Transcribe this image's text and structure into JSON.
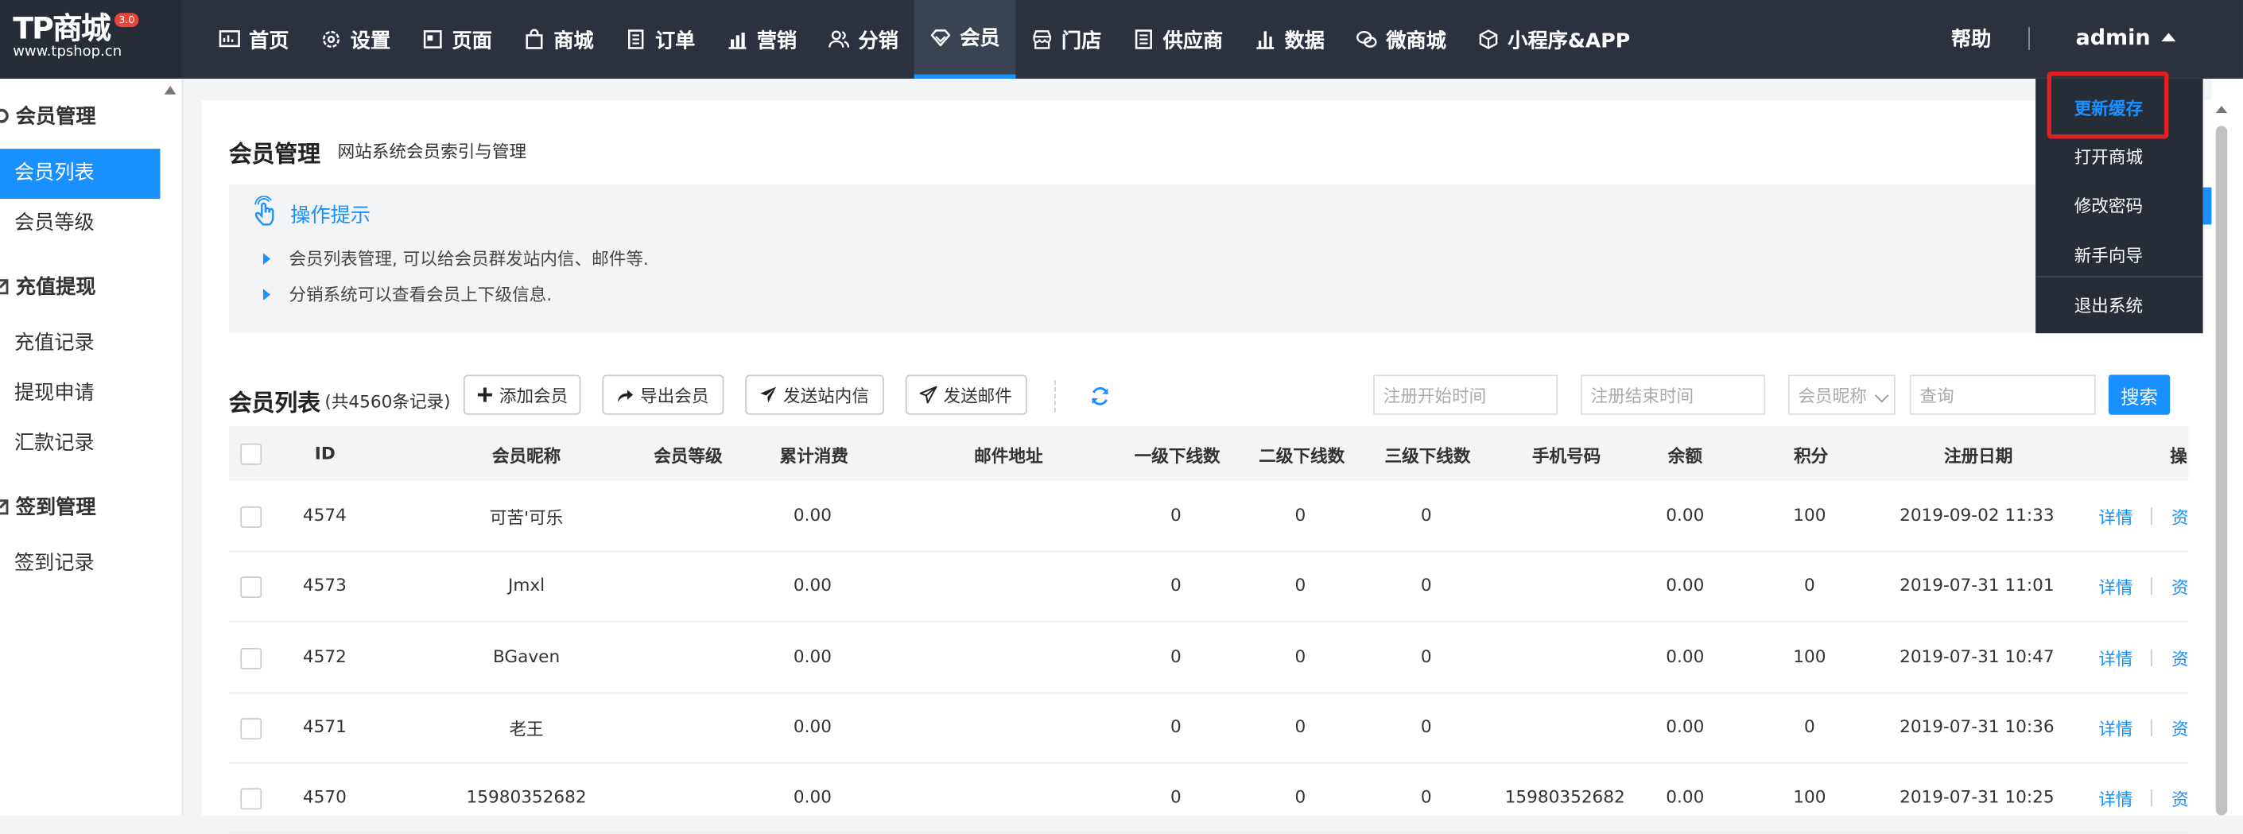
{
  "logo": {
    "title": "TP商城",
    "version": "3.0",
    "domain": "www.tpshop.cn"
  },
  "nav": [
    {
      "label": "首页",
      "icon": "dashboard-icon"
    },
    {
      "label": "设置",
      "icon": "gear-icon"
    },
    {
      "label": "页面",
      "icon": "page-icon"
    },
    {
      "label": "商城",
      "icon": "shopping-bag-icon"
    },
    {
      "label": "订单",
      "icon": "order-list-icon"
    },
    {
      "label": "营销",
      "icon": "bar-chart-icon"
    },
    {
      "label": "分销",
      "icon": "users-icon"
    },
    {
      "label": "会员",
      "icon": "diamond-icon",
      "active": true
    },
    {
      "label": "门店",
      "icon": "store-icon"
    },
    {
      "label": "供应商",
      "icon": "supplier-icon"
    },
    {
      "label": "数据",
      "icon": "data-chart-icon"
    },
    {
      "label": "微商城",
      "icon": "wechat-icon"
    },
    {
      "label": "小程序&APP",
      "icon": "cube-icon"
    }
  ],
  "header": {
    "help": "帮助",
    "user": "admin"
  },
  "user_menu": {
    "items": [
      "更新缓存",
      "打开商城",
      "修改密码",
      "新手向导",
      "退出系统"
    ],
    "highlighted": "更新缓存"
  },
  "sidebar": {
    "groups": [
      {
        "title": "会员管理",
        "items": [
          "会员列表",
          "会员等级"
        ]
      },
      {
        "title": "充值提现",
        "items": [
          "充值记录",
          "提现申请",
          "汇款记录"
        ]
      },
      {
        "title": "签到管理",
        "items": [
          "签到记录"
        ]
      }
    ],
    "active": "会员列表"
  },
  "page": {
    "title": "会员管理",
    "subtitle": "网站系统会员索引与管理"
  },
  "tips": {
    "title": "操作提示",
    "lines": [
      "会员列表管理, 可以给会员群发站内信、邮件等.",
      "分销系统可以查看会员上下级信息."
    ]
  },
  "list": {
    "title": "会员列表",
    "count": "(共4560条记录)",
    "buttons": [
      "添加会员",
      "导出会员",
      "发送站内信",
      "发送邮件"
    ],
    "filters": {
      "start_placeholder": "注册开始时间",
      "end_placeholder": "注册结束时间",
      "select_value": "会员昵称",
      "query_placeholder": "查询",
      "search": "搜索"
    }
  },
  "table": {
    "columns": [
      "ID",
      "会员昵称",
      "会员等级",
      "累计消费",
      "邮件地址",
      "一级下线数",
      "二级下线数",
      "三级下线数",
      "手机号码",
      "余额",
      "积分",
      "注册日期",
      "操"
    ],
    "rows": [
      {
        "id": "4574",
        "nickname": "可苦'可乐",
        "level": "",
        "spent": "0.00",
        "email": "",
        "l1": "0",
        "l2": "0",
        "l3": "0",
        "phone": "",
        "balance": "0.00",
        "points": "100",
        "date": "2019-09-02 11:33",
        "action": "详情",
        "action2": "资"
      },
      {
        "id": "4573",
        "nickname": "Jmxl",
        "level": "",
        "spent": "0.00",
        "email": "",
        "l1": "0",
        "l2": "0",
        "l3": "0",
        "phone": "",
        "balance": "0.00",
        "points": "0",
        "date": "2019-07-31 11:01",
        "action": "详情",
        "action2": "资"
      },
      {
        "id": "4572",
        "nickname": "BGaven",
        "level": "",
        "spent": "0.00",
        "email": "",
        "l1": "0",
        "l2": "0",
        "l3": "0",
        "phone": "",
        "balance": "0.00",
        "points": "100",
        "date": "2019-07-31 10:47",
        "action": "详情",
        "action2": "资"
      },
      {
        "id": "4571",
        "nickname": "老王",
        "level": "",
        "spent": "0.00",
        "email": "",
        "l1": "0",
        "l2": "0",
        "l3": "0",
        "phone": "",
        "balance": "0.00",
        "points": "0",
        "date": "2019-07-31 10:36",
        "action": "详情",
        "action2": "资"
      },
      {
        "id": "4570",
        "nickname": "15980352682",
        "level": "",
        "spent": "0.00",
        "email": "",
        "l1": "0",
        "l2": "0",
        "l3": "0",
        "phone": "15980352682",
        "balance": "0.00",
        "points": "100",
        "date": "2019-07-31 10:25",
        "action": "详情",
        "action2": "资"
      }
    ]
  },
  "colors": {
    "accent": "#1890ff",
    "topbar": "#2b323d",
    "highlight_box": "#e02020"
  }
}
